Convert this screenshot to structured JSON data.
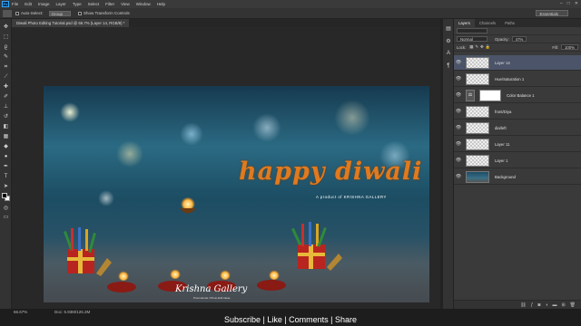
{
  "menubar": {
    "logo": "Ps",
    "items": [
      "File",
      "Edit",
      "Image",
      "Layer",
      "Type",
      "Select",
      "Filter",
      "View",
      "Window",
      "Help"
    ],
    "window_controls": [
      "–",
      "□",
      "✕"
    ]
  },
  "options_bar": {
    "auto_select_label": "Auto-Select:",
    "auto_select_value": "Group",
    "show_transform_label": "Show Transform Controls",
    "workspace": "Essentials"
  },
  "document_tab": {
    "title": "Diwali Photo Editing Tutorial.psd @ 66.7% (Layer 14, RGB/8) *"
  },
  "canvas": {
    "headline": "happy diwali",
    "product_line": "A product of KRISHNA GALLERY",
    "signature": "Krishna Gallery",
    "signature_sub": "Promotional / Photo Edit Ideas"
  },
  "layers_panel": {
    "tabs": [
      "Layers",
      "Channels",
      "Paths"
    ],
    "active_tab": "Layers",
    "blend_mode": "Normal",
    "opacity_label": "Opacity:",
    "opacity_value": "47%",
    "lock_label": "Lock:",
    "fill_label": "Fill:",
    "fill_value": "100%",
    "layers": [
      {
        "name": "Layer 14",
        "visible": true,
        "selected": true,
        "thumb": "transparent"
      },
      {
        "name": "Hue/Saturation 1",
        "visible": true,
        "selected": false,
        "thumb": "transparent"
      },
      {
        "name": "Color Balance 1",
        "visible": true,
        "selected": false,
        "thumb": "adjustment"
      },
      {
        "name": "front/Diya",
        "visible": true,
        "selected": false,
        "thumb": "transparent"
      },
      {
        "name": "dia/left",
        "visible": true,
        "selected": false,
        "thumb": "transparent"
      },
      {
        "name": "Layer 11",
        "visible": true,
        "selected": false,
        "thumb": "transparent"
      },
      {
        "name": "Layer 1",
        "visible": true,
        "selected": false,
        "thumb": "transparent"
      },
      {
        "name": "Background",
        "visible": true,
        "selected": false,
        "thumb": "image"
      }
    ],
    "footer_icons": [
      "link-icon",
      "fx-icon",
      "mask-icon",
      "adjustment-icon",
      "folder-icon",
      "new-layer-icon",
      "trash-icon"
    ]
  },
  "status_bar": {
    "zoom": "66.67%",
    "doc_info": "Doc: 5.93M/126.2M",
    "overlay_caption": "Subscribe | Like | Comments | Share"
  },
  "colors": {
    "accent_orange": "#e07a1e",
    "selected_layer": "#4b5468",
    "ui_dark": "#2b2b2b"
  }
}
